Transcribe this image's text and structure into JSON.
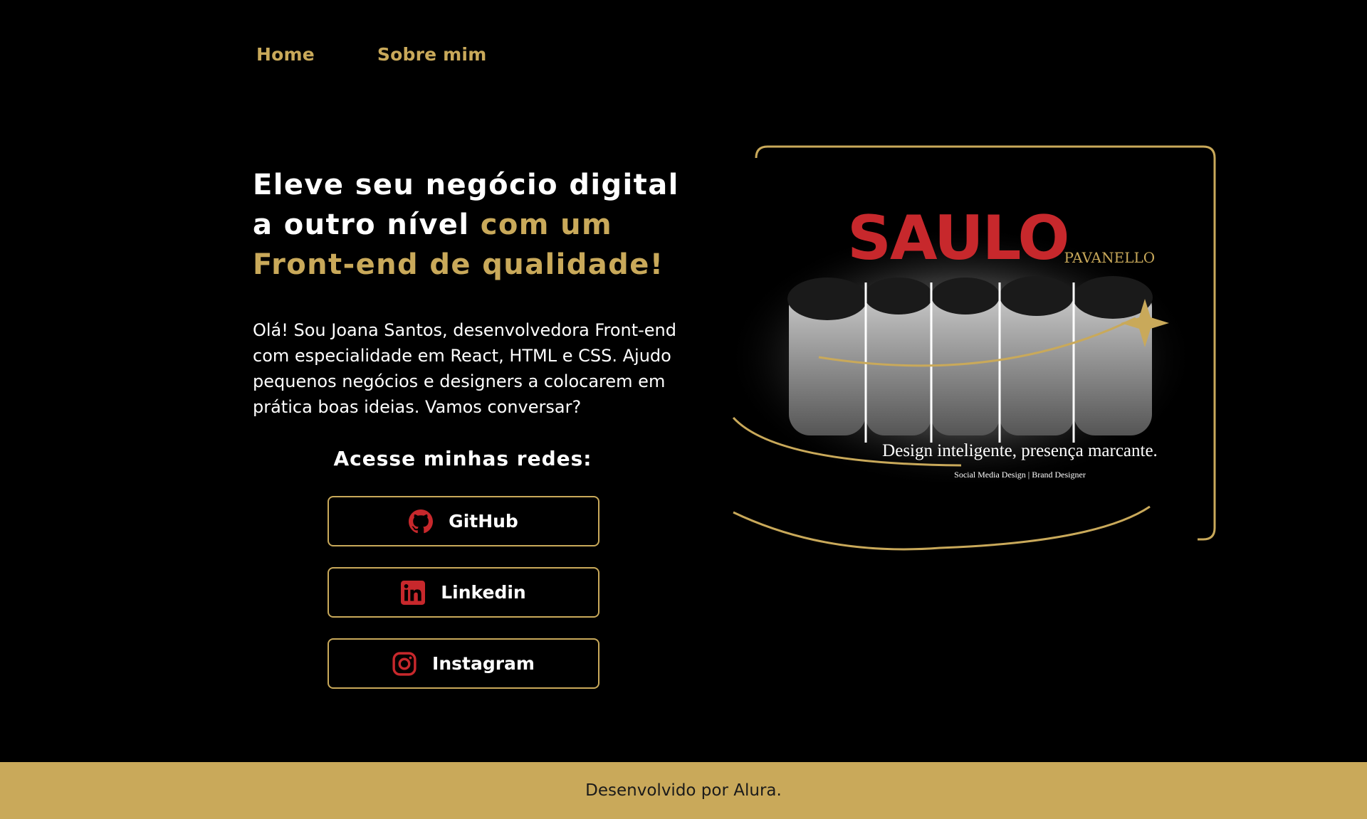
{
  "nav": {
    "items": [
      {
        "label": "Home"
      },
      {
        "label": "Sobre mim"
      }
    ]
  },
  "hero": {
    "title_line1": "Eleve seu negócio digital",
    "title_line2_white": "a outro nível ",
    "title_line2_gold": "com um",
    "title_line3_gold": "Front-end de qualidade!",
    "description": "Olá! Sou Joana Santos, desenvolvedora Front-end com especialidade em React, HTML e CSS. Ajudo pequenos negócios e designers a colocarem em prática boas ideias. Vamos conversar?"
  },
  "social": {
    "heading": "Acesse minhas redes:",
    "links": [
      {
        "label": "GitHub",
        "icon": "github-icon"
      },
      {
        "label": "Linkedin",
        "icon": "linkedin-icon"
      },
      {
        "label": "Instagram",
        "icon": "instagram-icon"
      }
    ]
  },
  "image_card": {
    "brand_main": "SAULO",
    "brand_sub": "PAVANELLO",
    "tagline": "Design inteligente, presença marcante.",
    "sub_tagline": "Social Media Design | Brand Designer"
  },
  "footer": {
    "text": "Desenvolvido por Alura."
  },
  "colors": {
    "background": "#000000",
    "gold": "#c9a95a",
    "red": "#c7282c",
    "white": "#ffffff"
  }
}
